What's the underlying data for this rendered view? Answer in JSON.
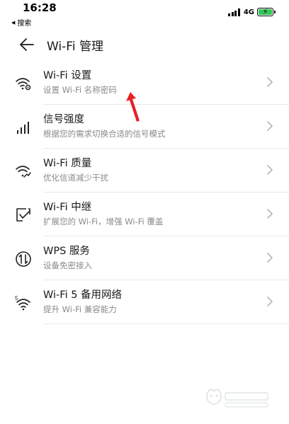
{
  "status_bar": {
    "time": "16:28",
    "back_label": "搜索",
    "network": "4G",
    "battery_color": "#35c759"
  },
  "header": {
    "title": "Wi-Fi 管理",
    "back_icon": "arrow-left-icon"
  },
  "items": [
    {
      "icon": "wifi-settings-icon",
      "label": "Wi-Fi 设置",
      "sub": "设置 Wi-Fi 名称密码"
    },
    {
      "icon": "signal-strength-icon",
      "label": "信号强度",
      "sub": "根据您的需求切换合适的信号模式"
    },
    {
      "icon": "wifi-quality-icon",
      "label": "Wi-Fi 质量",
      "sub": "优化信道减少干扰"
    },
    {
      "icon": "wifi-relay-icon",
      "label": "Wi-Fi 中继",
      "sub": "扩展您的 Wi-Fi，增强 Wi-Fi 覆盖"
    },
    {
      "icon": "wps-icon",
      "label": "WPS 服务",
      "sub": "设备免密接入"
    },
    {
      "icon": "wifi5-icon",
      "label": "Wi-Fi 5 备用网络",
      "sub": "提升 Wi-Fi 兼容能力"
    }
  ],
  "annotation_color": "#e8202a"
}
